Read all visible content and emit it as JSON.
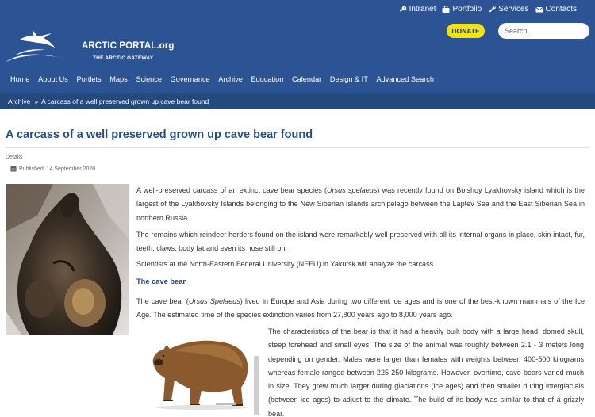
{
  "header": {
    "site_title": "ARCTIC PORTAL.org",
    "site_subtitle": "THE ARCTIC GATEWAY",
    "top_links": [
      {
        "label": "Intranet",
        "icon": "key-icon"
      },
      {
        "label": "Portfolio",
        "icon": "briefcase-icon"
      },
      {
        "label": "Services",
        "icon": "wrench-icon"
      },
      {
        "label": "Contacts",
        "icon": "envelope-icon"
      }
    ],
    "donate_label": "DONATE",
    "search_placeholder": "Search...",
    "nav": [
      "Home",
      "About Us",
      "Portlets",
      "Maps",
      "Science",
      "Governance",
      "Archive",
      "Education",
      "Calendar",
      "Design & IT",
      "Advanced Search"
    ]
  },
  "breadcrumb": {
    "items": [
      "Archive",
      "A carcass of a well preserved grown up cave bear found"
    ],
    "separator": "»"
  },
  "article": {
    "title": "A carcass of a well preserved grown up cave bear found",
    "details_label": "Details",
    "published": "Published: 14 September 2020",
    "p1_a": "A well-preserved carcass of an extinct cave bear species (",
    "p1_em": "Ursus spelaeus",
    "p1_b": ") was recently found on Bolshoy Lyakhovsky island which is the largest of the Lyakhovsky Islands belonging to the New Siberian Islands archipelago between the Laptev Sea and the East Siberian Sea in northern Russia.",
    "p2": "The remains which reindeer herders found on the island were remarkably well preserved with all its internal organs in place, skin intact, fur, teeth, claws, body fat and even its nose still on.",
    "p3": "Scientists at the North-Eastern Federal University (NEFU) in Yakutsk will analyze the carcass.",
    "subheading": "The cave bear",
    "p4_a": "The cave bear (",
    "p4_em": "Ursus Spelaeus",
    "p4_b": ") lived in Europe and Asia during two different ice ages and is one of the best-known mammals of the Ice Age. The estimated time of the species extinction varies from 27,800 years ago to 8,000 years ago.",
    "p5": "The characteristics of the bear is that it had a heavily built body with a large head, domed skull, steep forehead and small eyes. The size of the animal was roughly between 2.1 - 3 meters long depending on gender. Males were larger than females with weights between 400-500 kilograms whereas female ranged between 225-250 kilograms. However, overtime, cave bears varied much in size. They grew much larger during glaciations (ice ages) and then smaller during interglacials (between ice ages) to adjust to the climate. The build of its body was similar to that of a grizzly bear."
  },
  "colors": {
    "header_bg": "#2c5494",
    "breadcrumb_bg": "#23497f",
    "title": "#234f84",
    "donate_bg": "#f4e40c"
  }
}
